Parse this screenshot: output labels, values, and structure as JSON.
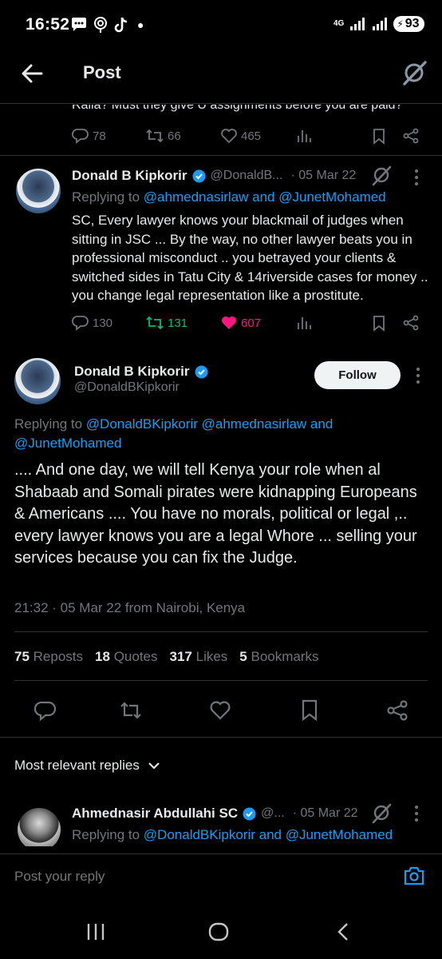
{
  "status": {
    "time": "16:52",
    "network": "4G",
    "battery": "93"
  },
  "header": {
    "title": "Post"
  },
  "top_tweet": {
    "partial_text": "Raila? Must they give U assignments before you are paid?",
    "replies": "78",
    "reposts": "66",
    "likes": "465"
  },
  "reply_tweet": {
    "name": "Donald B Kipkorir",
    "handle": "@DonaldB...",
    "date": "· 05 Mar 22",
    "replying_prefix": "Replying to",
    "replying_to": "@ahmednasirlaw and @JunetMohamed",
    "text": "SC, Every lawyer knows your blackmail of judges when sitting in JSC ... By the way, no other lawyer beats you in professional misconduct .. you betrayed your clients & switched sides in Tatu City & 14riverside cases for money .. you change legal representation like a prostitute.",
    "replies": "130",
    "reposts": "131",
    "likes": "607"
  },
  "main_tweet": {
    "name": "Donald B Kipkorir",
    "handle": "@DonaldBKipkorir",
    "follow_label": "Follow",
    "replying_prefix": "Replying to",
    "replying_to": "@DonaldBKipkorir @ahmednasirlaw and @JunetMohamed",
    "text": ".... And one day, we will tell Kenya your role when al Shabaab and Somali pirates were kidnapping Europeans & Americans .... You have no morals, political or legal  ,.. every lawyer knows you are a legal Whore ... selling your services because you can fix the Judge.",
    "timestamp": "21:32 · 05 Mar 22 from Nairobi, Kenya",
    "stats": {
      "reposts_count": "75",
      "reposts_label": "Reposts",
      "quotes_count": "18",
      "quotes_label": "Quotes",
      "likes_count": "317",
      "likes_label": "Likes",
      "bookmarks_count": "5",
      "bookmarks_label": "Bookmarks"
    }
  },
  "sort": {
    "label": "Most relevant replies"
  },
  "next_reply": {
    "name": "Ahmednasir Abdullahi SC",
    "handle": "@...",
    "date": "· 05 Mar 22",
    "replying_prefix": "Replying to",
    "replying_to": "@DonaldBKipkorir and @JunetMohamed"
  },
  "reply_input": {
    "placeholder": "Post your reply"
  },
  "colors": {
    "accent": "#1d9bf0",
    "like": "#f91880",
    "repost": "#00ba7c",
    "muted": "#71767b"
  }
}
